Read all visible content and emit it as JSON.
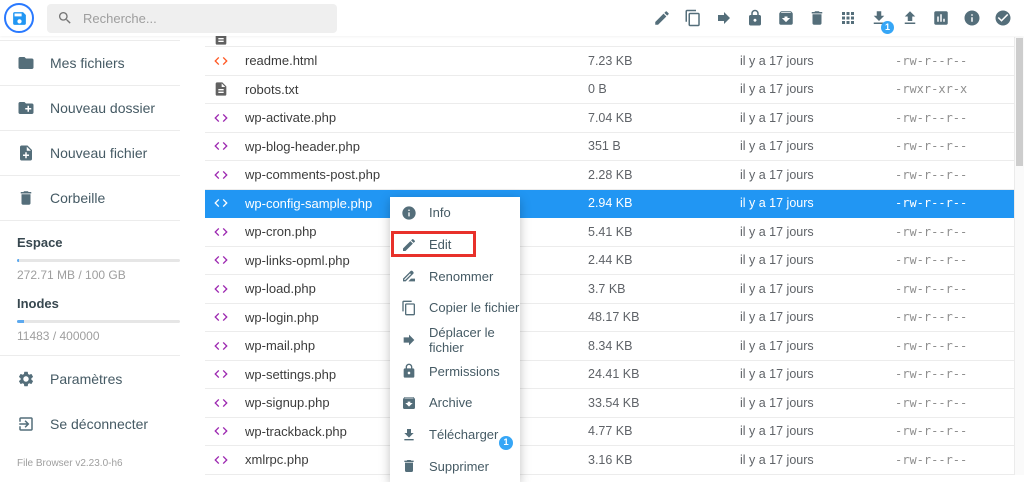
{
  "header": {
    "search_placeholder": "Recherche...",
    "toolbar": [
      {
        "name": "edit",
        "icon": "edit"
      },
      {
        "name": "copy",
        "icon": "copy"
      },
      {
        "name": "move",
        "icon": "move"
      },
      {
        "name": "permissions",
        "icon": "lock"
      },
      {
        "name": "archive",
        "icon": "archive"
      },
      {
        "name": "delete",
        "icon": "trash"
      },
      {
        "name": "switch-view",
        "icon": "grid"
      },
      {
        "name": "download",
        "icon": "download",
        "badge": "1"
      },
      {
        "name": "upload",
        "icon": "upload"
      },
      {
        "name": "stats",
        "icon": "stats"
      },
      {
        "name": "info",
        "icon": "info"
      },
      {
        "name": "select-multiple",
        "icon": "check"
      }
    ]
  },
  "sidebar": {
    "items": [
      {
        "name": "mes-fichiers",
        "icon": "folder",
        "label": "Mes fichiers"
      },
      {
        "name": "nouveau-dossier",
        "icon": "new-folder",
        "label": "Nouveau dossier"
      },
      {
        "name": "nouveau-fichier",
        "icon": "new-file",
        "label": "Nouveau fichier"
      },
      {
        "name": "corbeille",
        "icon": "trash",
        "label": "Corbeille"
      }
    ],
    "usage": {
      "space_label": "Espace",
      "space_value": "272.71 MB / 100 GB",
      "space_percent": 1.2,
      "inodes_label": "Inodes",
      "inodes_value": "11483 / 400000",
      "inodes_percent": 4.5
    },
    "bottom_items": [
      {
        "name": "parametres",
        "icon": "gear",
        "label": "Paramètres"
      },
      {
        "name": "se-deconnecter",
        "icon": "logout",
        "label": "Se déconnecter"
      }
    ],
    "version": "File Browser v2.23.0-h6"
  },
  "files": {
    "partial_row": {
      "icon": "doc"
    },
    "rows": [
      {
        "icon": "code",
        "color": "#FF5722",
        "name": "readme.html",
        "size": "7.23 KB",
        "modified": "il y a 17 jours",
        "perms": "-rw-r--r--",
        "selected": false
      },
      {
        "icon": "doc",
        "color": "#616161",
        "name": "robots.txt",
        "size": "0 B",
        "modified": "il y a 17 jours",
        "perms": "-rwxr-xr-x",
        "selected": false
      },
      {
        "icon": "code",
        "color": "#9C27B0",
        "name": "wp-activate.php",
        "size": "7.04 KB",
        "modified": "il y a 17 jours",
        "perms": "-rw-r--r--",
        "selected": false
      },
      {
        "icon": "code",
        "color": "#9C27B0",
        "name": "wp-blog-header.php",
        "size": "351 B",
        "modified": "il y a 17 jours",
        "perms": "-rw-r--r--",
        "selected": false
      },
      {
        "icon": "code",
        "color": "#9C27B0",
        "name": "wp-comments-post.php",
        "size": "2.28 KB",
        "modified": "il y a 17 jours",
        "perms": "-rw-r--r--",
        "selected": false
      },
      {
        "icon": "code",
        "color": "#9C27B0",
        "name": "wp-config-sample.php",
        "size": "2.94 KB",
        "modified": "il y a 17 jours",
        "perms": "-rw-r--r--",
        "selected": true
      },
      {
        "icon": "code",
        "color": "#9C27B0",
        "name": "wp-cron.php",
        "size": "5.41 KB",
        "modified": "il y a 17 jours",
        "perms": "-rw-r--r--",
        "selected": false
      },
      {
        "icon": "code",
        "color": "#9C27B0",
        "name": "wp-links-opml.php",
        "size": "2.44 KB",
        "modified": "il y a 17 jours",
        "perms": "-rw-r--r--",
        "selected": false
      },
      {
        "icon": "code",
        "color": "#9C27B0",
        "name": "wp-load.php",
        "size": "3.7 KB",
        "modified": "il y a 17 jours",
        "perms": "-rw-r--r--",
        "selected": false
      },
      {
        "icon": "code",
        "color": "#9C27B0",
        "name": "wp-login.php",
        "size": "48.17 KB",
        "modified": "il y a 17 jours",
        "perms": "-rw-r--r--",
        "selected": false
      },
      {
        "icon": "code",
        "color": "#9C27B0",
        "name": "wp-mail.php",
        "size": "8.34 KB",
        "modified": "il y a 17 jours",
        "perms": "-rw-r--r--",
        "selected": false
      },
      {
        "icon": "code",
        "color": "#9C27B0",
        "name": "wp-settings.php",
        "size": "24.41 KB",
        "modified": "il y a 17 jours",
        "perms": "-rw-r--r--",
        "selected": false
      },
      {
        "icon": "code",
        "color": "#9C27B0",
        "name": "wp-signup.php",
        "size": "33.54 KB",
        "modified": "il y a 17 jours",
        "perms": "-rw-r--r--",
        "selected": false
      },
      {
        "icon": "code",
        "color": "#9C27B0",
        "name": "wp-trackback.php",
        "size": "4.77 KB",
        "modified": "il y a 17 jours",
        "perms": "-rw-r--r--",
        "selected": false
      },
      {
        "icon": "code",
        "color": "#9C27B0",
        "name": "xmlrpc.php",
        "size": "3.16 KB",
        "modified": "il y a 17 jours",
        "perms": "-rw-r--r--",
        "selected": false
      }
    ]
  },
  "context_menu": {
    "items": [
      {
        "name": "info",
        "icon": "info",
        "label": "Info"
      },
      {
        "name": "edit",
        "icon": "edit",
        "label": "Edit",
        "highlighted": true
      },
      {
        "name": "renommer",
        "icon": "rename",
        "label": "Renommer"
      },
      {
        "name": "copier",
        "icon": "copy",
        "label": "Copier le fichier"
      },
      {
        "name": "deplacer",
        "icon": "move",
        "label": "Déplacer le fichier"
      },
      {
        "name": "permissions",
        "icon": "lock",
        "label": "Permissions"
      },
      {
        "name": "archive",
        "icon": "archive",
        "label": "Archive"
      },
      {
        "name": "telecharger",
        "icon": "download",
        "label": "Télécharger",
        "badge": "1"
      },
      {
        "name": "supprimer",
        "icon": "trash",
        "label": "Supprimer"
      }
    ]
  },
  "colors": {
    "accent": "#2196F3",
    "selection": "#2196F3",
    "badge_blue": "#36A6F6",
    "highlight_red": "#E8312A",
    "icon_slate": "#546E7A",
    "php_purple": "#9C27B0",
    "html_orange": "#FF5722",
    "txt_gray": "#616161",
    "progress_fill": "#5CA9EF"
  }
}
